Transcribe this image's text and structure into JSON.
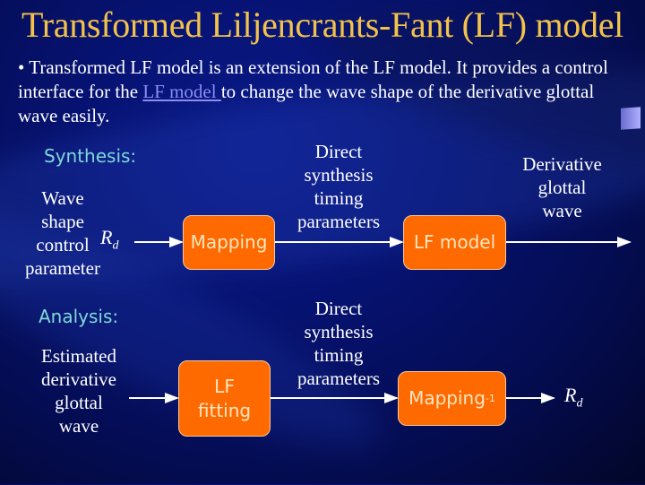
{
  "title": "Transformed Liljencrants-Fant (LF) model",
  "bullet": {
    "marker": "•",
    "text_before": " Transformed LF model is an extension of the LF model. It provides a control interface for the ",
    "link": "LF model ",
    "text_after": "to change the wave shape of the derivative glottal wave easily."
  },
  "synthesis": {
    "label": "Synthesis:",
    "input_label": [
      "Wave",
      "shape",
      "control",
      "parameter"
    ],
    "rd_symbol": "R",
    "rd_subscript": "d",
    "box1": "Mapping",
    "mid_label": [
      "Direct",
      "synthesis",
      "timing",
      "parameters"
    ],
    "box2": "LF model",
    "output_label": [
      "Derivative",
      "glottal",
      "wave"
    ]
  },
  "analysis": {
    "label": "Analysis:",
    "input_label": [
      "Estimated",
      "derivative",
      "glottal",
      "wave"
    ],
    "box1": [
      "LF",
      "fitting"
    ],
    "mid_label": [
      "Direct",
      "synthesis",
      "timing",
      "parameters"
    ],
    "box2": "Mapping",
    "box2_superscript": "-1",
    "output_symbol": "R",
    "output_subscript": "d"
  },
  "colors": {
    "title": "#f2c24a",
    "box_fill": "#ff6a00",
    "section_label": "#7fd8d8",
    "link": "#8c8cf0"
  }
}
